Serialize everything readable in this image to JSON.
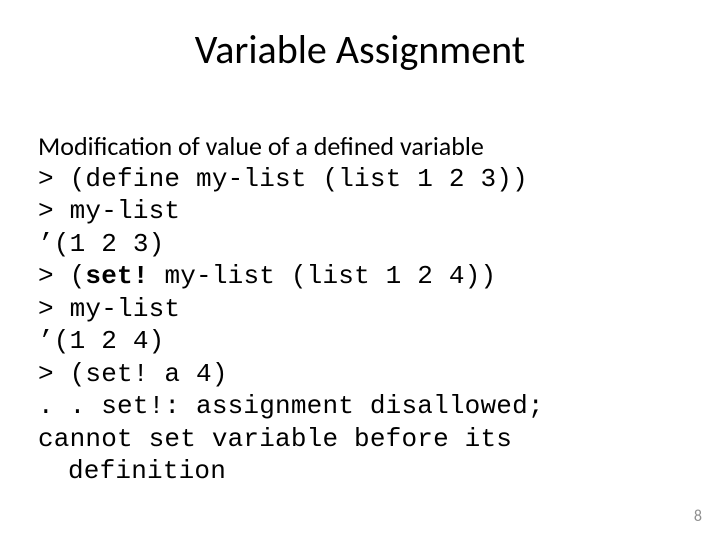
{
  "slide": {
    "title": "Variable Assignment",
    "intro": "Modification of value of a defined variable",
    "code": {
      "l1": "> (define my-list (list 1 2 3))",
      "l2": "> my-list",
      "l3": "’(1 2 3)",
      "l4a": "> (",
      "l4b": "set!",
      "l4c": " my-list (list 1 2 4))",
      "l5": "> my-list",
      "l6": "’(1 2 4)",
      "l7": "> (set! a 4)",
      "l8": ". . set!: assignment disallowed;",
      "l9": "cannot set variable before its",
      "l10": "definition"
    },
    "page_number": "8"
  }
}
